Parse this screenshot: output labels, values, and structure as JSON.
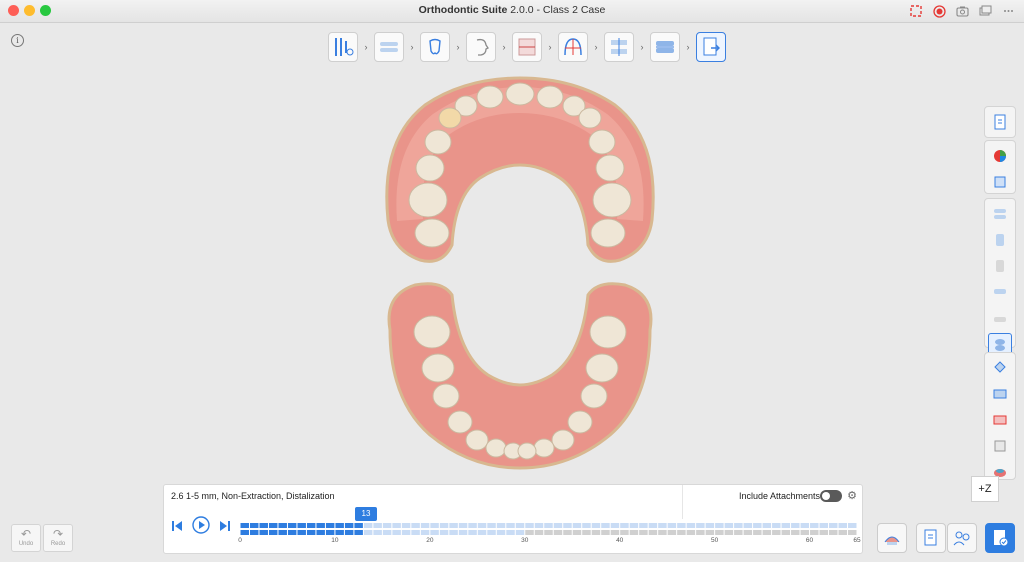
{
  "window": {
    "app_name": "Orthodontic Suite",
    "version_and_case": "2.0.0 - Class 2 Case",
    "traffic_lights": [
      "#fe5f57",
      "#febc2e",
      "#28c840"
    ]
  },
  "titlebar_icons": [
    "fullscreen-icon",
    "record-icon",
    "camera-icon",
    "window-icon",
    "more-icon"
  ],
  "info_glyph": "i",
  "workflow_steps": [
    {
      "name": "tools-step",
      "active": false
    },
    {
      "name": "dentition-step",
      "active": false
    },
    {
      "name": "tooth-step",
      "active": false
    },
    {
      "name": "face-step",
      "active": false
    },
    {
      "name": "analysis-step",
      "active": false
    },
    {
      "name": "arch-step",
      "active": false
    },
    {
      "name": "setup-step",
      "active": false
    },
    {
      "name": "staging-step",
      "active": false
    },
    {
      "name": "export-step",
      "active": true
    }
  ],
  "z_button": "+Z",
  "timeline": {
    "plan_text": "2.6 1-5 mm, Non-Extraction, Distalization",
    "include_attachments_label": "Include Attachments",
    "include_attachments_on": false,
    "current_stage": "13",
    "current_stage_value": 13,
    "total_stages": 65,
    "tick_labels": [
      "0",
      "10",
      "20",
      "30",
      "40",
      "50",
      "60",
      "65"
    ],
    "tick_values": [
      0,
      10,
      20,
      30,
      40,
      50,
      60,
      65
    ]
  },
  "undo_label": "Undo",
  "redo_label": "Redo",
  "colors": {
    "accent": "#2e7de0",
    "gum": "#e9948a",
    "tooth": "#efe6d6"
  }
}
